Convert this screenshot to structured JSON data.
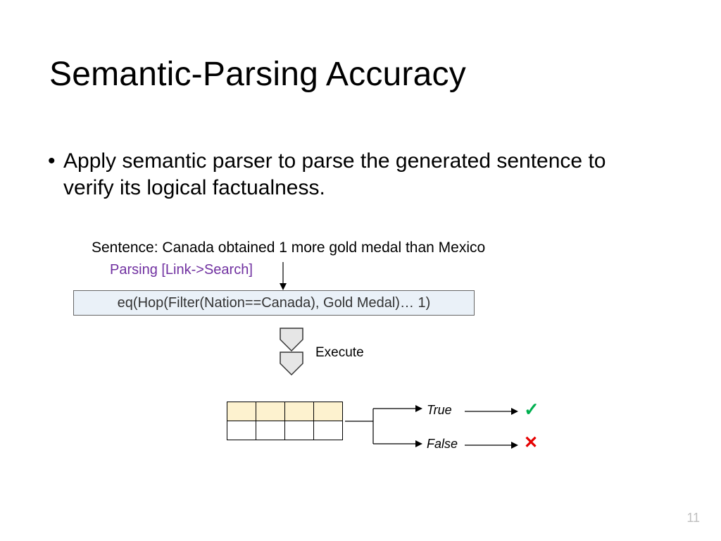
{
  "title": "Semantic-Parsing Accuracy",
  "bullet": "Apply semantic parser to parse the generated sentence to verify its logical factualness.",
  "sentence": "Sentence: Canada obtained 1 more gold medal than Mexico",
  "parsing_label": "Parsing [Link->Search]",
  "expression": "eq(Hop(Filter(Nation==Canada), Gold Medal)… 1)",
  "execute_label": "Execute",
  "branch": {
    "true_label": "True",
    "false_label": "False"
  },
  "icons": {
    "check": "✓",
    "cross": "✕"
  },
  "page_number": "11",
  "table": {
    "rows": 2,
    "cols": 4
  }
}
